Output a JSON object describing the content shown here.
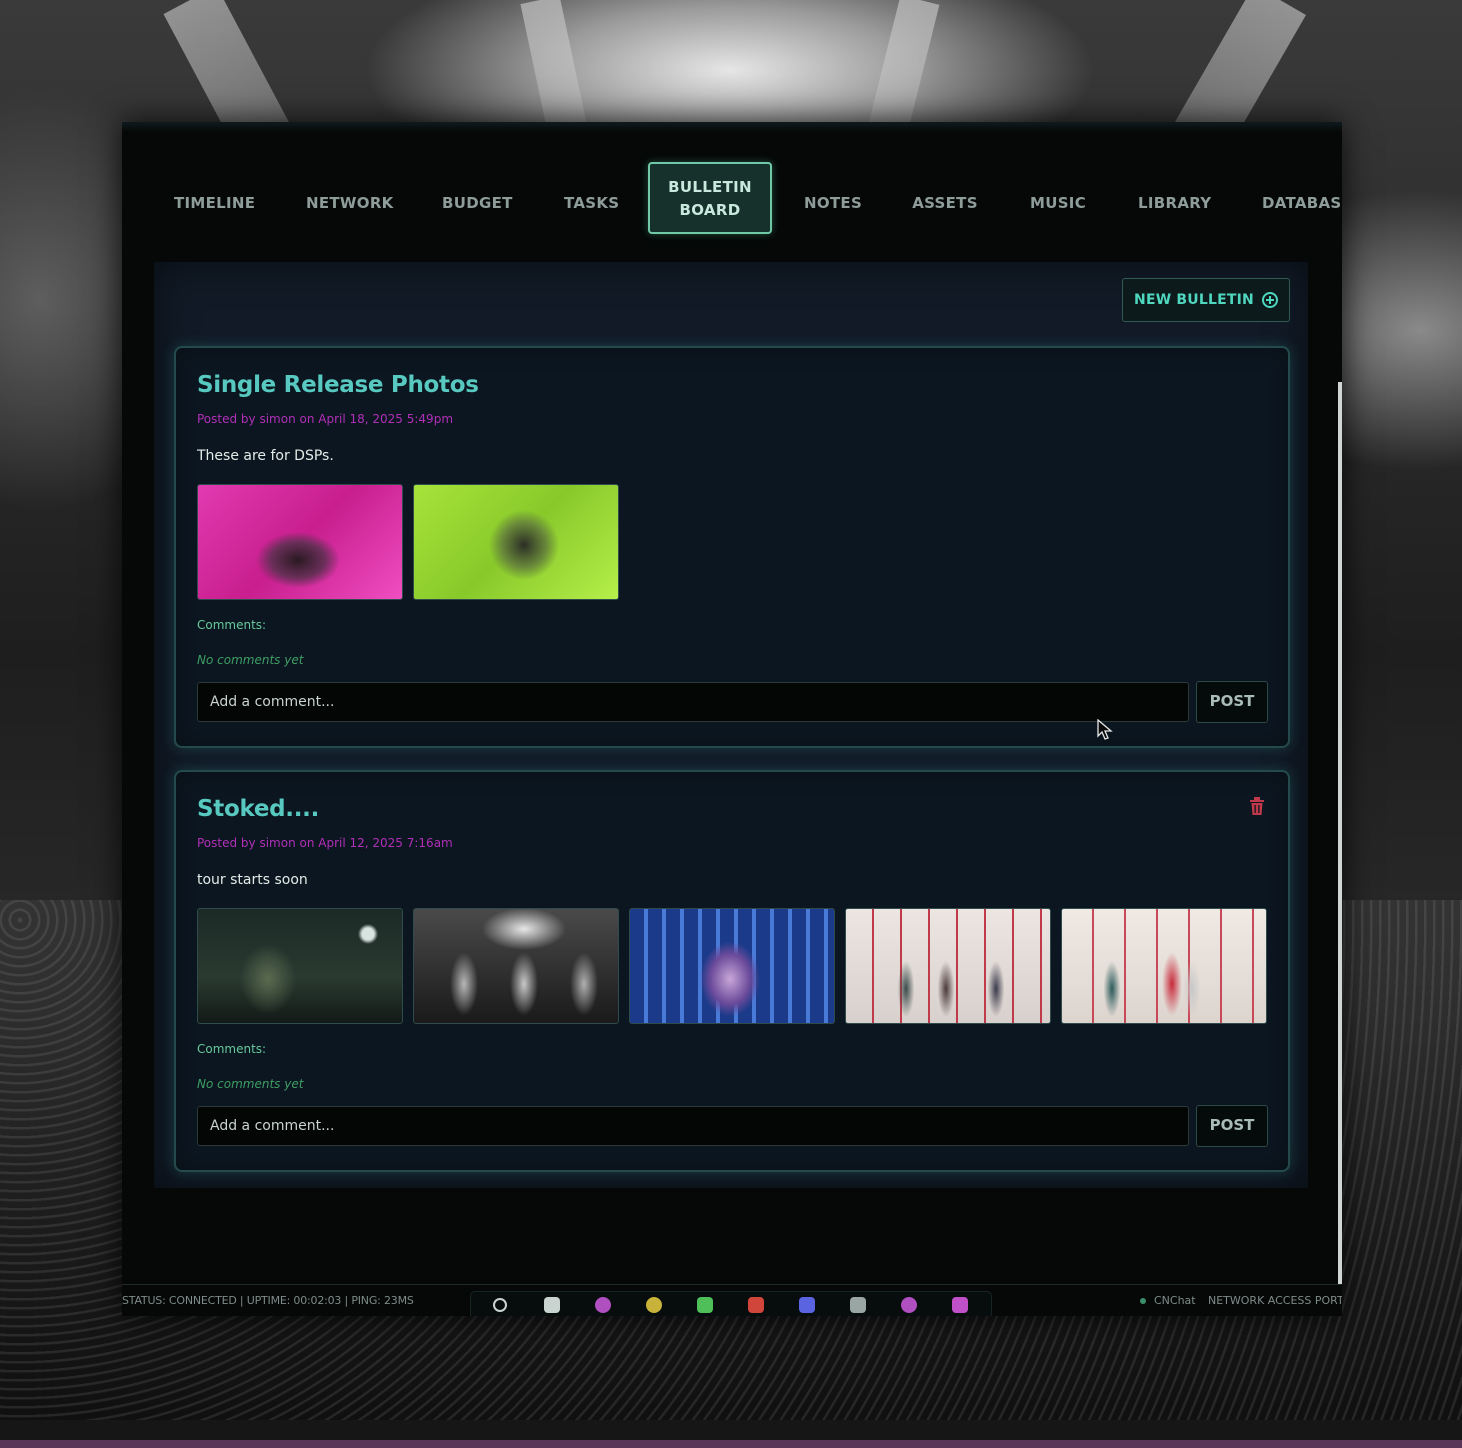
{
  "nav": {
    "tabs": [
      {
        "label": "TIMELINE"
      },
      {
        "label": "NETWORK"
      },
      {
        "label": "BUDGET"
      },
      {
        "label": "TASKS"
      },
      {
        "label": "BULLETIN BOARD",
        "line1": "BULLETIN",
        "line2": "BOARD",
        "active": true
      },
      {
        "label": "NOTES"
      },
      {
        "label": "ASSETS"
      },
      {
        "label": "MUSIC"
      },
      {
        "label": "LIBRARY"
      },
      {
        "label": "DATABASE"
      }
    ]
  },
  "board": {
    "new_bulletin_label": "NEW BULLETIN",
    "posts": [
      {
        "title": "Single Release Photos",
        "meta": "Posted by simon on April 18, 2025 5:49pm",
        "body": "These are for DSPs.",
        "image_count": 2,
        "comments_label": "Comments:",
        "no_comments": "No comments yet",
        "comment_placeholder": "Add a comment...",
        "post_label": "POST"
      },
      {
        "title": "Stoked....",
        "meta": "Posted by simon on April 12, 2025 7:16am",
        "body": "tour starts soon",
        "image_count": 5,
        "comments_label": "Comments:",
        "no_comments": "No comments yet",
        "comment_placeholder": "Add a comment...",
        "post_label": "POST"
      }
    ]
  },
  "status": {
    "text": "STATUS: CONNECTED | UPTIME: 00:02:03 | PING: 23MS",
    "chat_label": "CNChat",
    "network_label": "NETWORK ACCESS PORT",
    "dock_icons": [
      {
        "name": "search-icon",
        "color": "#c9d4d0"
      },
      {
        "name": "calendar-icon",
        "color": "#c9d4d0"
      },
      {
        "name": "network-icon",
        "color": "#b04fbf"
      },
      {
        "name": "budget-icon",
        "color": "#c8b23a"
      },
      {
        "name": "tasks-icon",
        "color": "#4fbf5a"
      },
      {
        "name": "bulletin-icon",
        "color": "#d0463a"
      },
      {
        "name": "notes-icon",
        "color": "#5a63e0"
      },
      {
        "name": "assets-icon",
        "color": "#9aa6a4"
      },
      {
        "name": "music-icon",
        "color": "#b04fbf"
      },
      {
        "name": "library-icon",
        "color": "#c050c8"
      }
    ]
  },
  "colors": {
    "accent": "#57c9c0",
    "meta": "#b02fb8",
    "active_tab_border": "#6fc8a6",
    "trash": "#c0394a"
  }
}
